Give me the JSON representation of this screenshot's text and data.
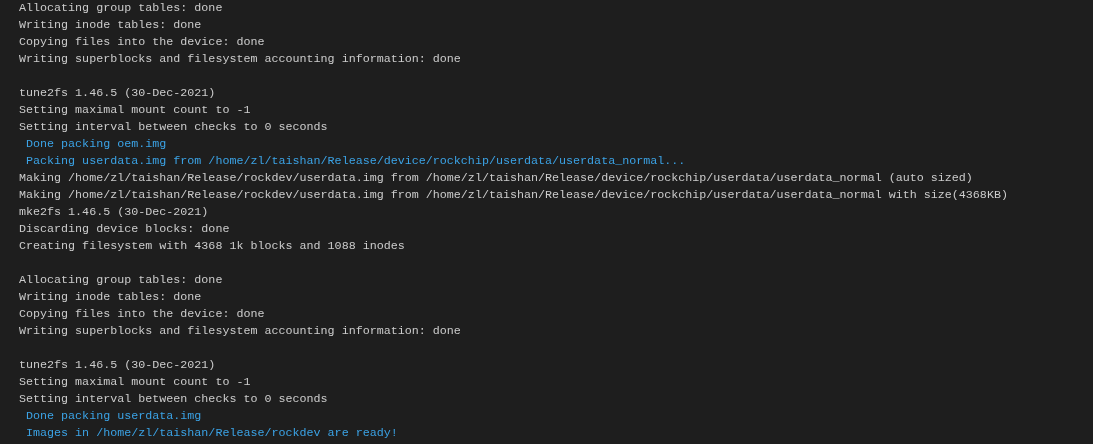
{
  "terminal": {
    "lines": [
      {
        "kind": "output",
        "text": "Allocating group tables: done"
      },
      {
        "kind": "output",
        "text": "Writing inode tables: done"
      },
      {
        "kind": "output",
        "text": "Copying files into the device: done"
      },
      {
        "kind": "output",
        "text": "Writing superblocks and filesystem accounting information: done"
      },
      {
        "kind": "blank"
      },
      {
        "kind": "output",
        "text": "tune2fs 1.46.5 (30-Dec-2021)"
      },
      {
        "kind": "output",
        "text": "Setting maximal mount count to -1"
      },
      {
        "kind": "output",
        "text": "Setting interval between checks to 0 seconds"
      },
      {
        "kind": "info",
        "text": " Done packing oem.img"
      },
      {
        "kind": "info",
        "text": " Packing userdata.img from /home/zl/taishan/Release/device/rockchip/userdata/userdata_normal..."
      },
      {
        "kind": "output",
        "text": "Making /home/zl/taishan/Release/rockdev/userdata.img from /home/zl/taishan/Release/device/rockchip/userdata/userdata_normal (auto sized)"
      },
      {
        "kind": "output",
        "text": "Making /home/zl/taishan/Release/rockdev/userdata.img from /home/zl/taishan/Release/device/rockchip/userdata/userdata_normal with size(4368KB)"
      },
      {
        "kind": "output",
        "text": "mke2fs 1.46.5 (30-Dec-2021)"
      },
      {
        "kind": "output",
        "text": "Discarding device blocks: done"
      },
      {
        "kind": "output",
        "text": "Creating filesystem with 4368 1k blocks and 1088 inodes"
      },
      {
        "kind": "blank"
      },
      {
        "kind": "output",
        "text": "Allocating group tables: done"
      },
      {
        "kind": "output",
        "text": "Writing inode tables: done"
      },
      {
        "kind": "output",
        "text": "Copying files into the device: done"
      },
      {
        "kind": "output",
        "text": "Writing superblocks and filesystem accounting information: done"
      },
      {
        "kind": "blank"
      },
      {
        "kind": "output",
        "text": "tune2fs 1.46.5 (30-Dec-2021)"
      },
      {
        "kind": "output",
        "text": "Setting maximal mount count to -1"
      },
      {
        "kind": "output",
        "text": "Setting interval between checks to 0 seconds"
      },
      {
        "kind": "info",
        "text": " Done packing userdata.img"
      },
      {
        "kind": "info",
        "text": " Images in /home/zl/taishan/Release/rockdev are ready!"
      }
    ]
  }
}
